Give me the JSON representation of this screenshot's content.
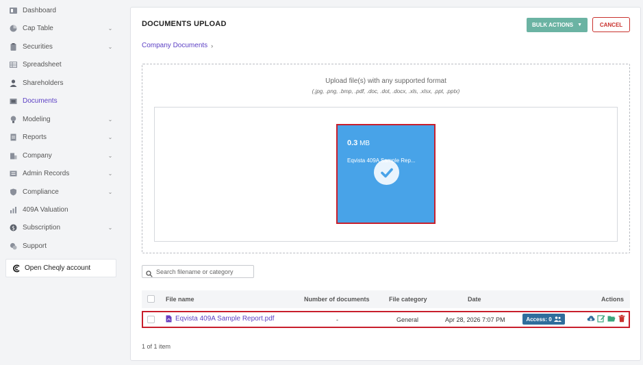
{
  "sidebar": {
    "items": [
      {
        "label": "Dashboard",
        "icon": "dashboard-icon",
        "chevron": false
      },
      {
        "label": "Cap Table",
        "icon": "pie-chart-icon",
        "chevron": true
      },
      {
        "label": "Securities",
        "icon": "clipboard-icon",
        "chevron": true
      },
      {
        "label": "Spreadsheet",
        "icon": "spreadsheet-icon",
        "chevron": false
      },
      {
        "label": "Shareholders",
        "icon": "user-icon",
        "chevron": false
      },
      {
        "label": "Documents",
        "icon": "folder-icon",
        "chevron": false,
        "active": true
      },
      {
        "label": "Modeling",
        "icon": "lightbulb-icon",
        "chevron": true
      },
      {
        "label": "Reports",
        "icon": "report-icon",
        "chevron": true
      },
      {
        "label": "Company",
        "icon": "building-icon",
        "chevron": true
      },
      {
        "label": "Admin Records",
        "icon": "records-icon",
        "chevron": true
      },
      {
        "label": "Compliance",
        "icon": "shield-icon",
        "chevron": true
      },
      {
        "label": "409A Valuation",
        "icon": "valuation-icon",
        "chevron": false
      },
      {
        "label": "Subscription",
        "icon": "dollar-icon",
        "chevron": true
      },
      {
        "label": "Support",
        "icon": "support-icon",
        "chevron": false
      }
    ],
    "cheqly_label": "Open Cheqly account"
  },
  "header": {
    "title": "DOCUMENTS UPLOAD",
    "bulk_actions_label": "BULK ACTIONS",
    "cancel_label": "CANCEL"
  },
  "breadcrumb": {
    "label": "Company Documents"
  },
  "upload": {
    "title": "Upload file(s) with any supported format",
    "formats": "(.jpg, .png, .bmp, .pdf, .doc, .dot, .docx, .xls, .xlsx, .ppt, .pptx)",
    "file_size_value": "0.3",
    "file_size_unit": "MB",
    "file_name": "Eqvista 409A Sample Rep..."
  },
  "search": {
    "placeholder": "Search filename or category"
  },
  "table": {
    "headers": {
      "file_name": "File name",
      "number_of_documents": "Number of documents",
      "file_category": "File category",
      "date": "Date",
      "actions": "Actions"
    },
    "rows": [
      {
        "file_name": "Eqvista 409A Sample Report.pdf",
        "number_of_documents": "-",
        "file_category": "General",
        "date": "Apr 28, 2026 7:07 PM",
        "access_label": "Access: 0"
      }
    ]
  },
  "pagination": {
    "summary": "1 of 1 item"
  },
  "colors": {
    "accent": "#5b3fc4",
    "upload_tile": "#48a3e8",
    "highlight_border": "#c81e2b",
    "bulk_button": "#6bb3a3",
    "access_button": "#2f6d9c",
    "delete": "#c9302c"
  }
}
